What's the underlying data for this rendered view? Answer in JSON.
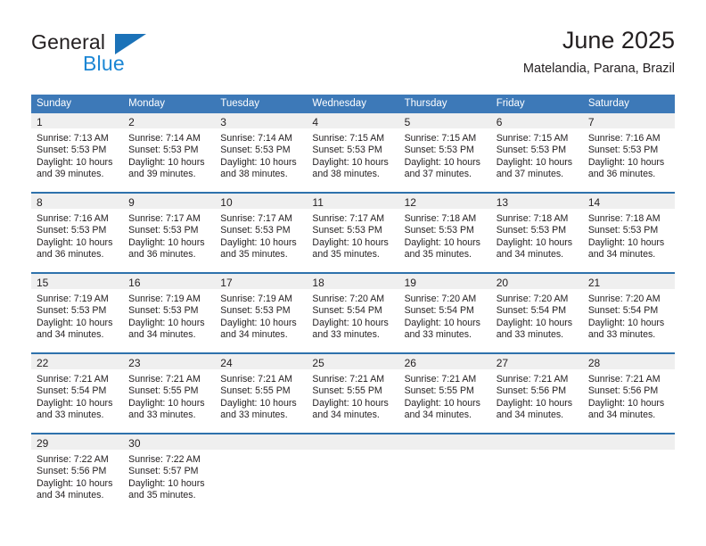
{
  "brand": {
    "name_top": "General",
    "name_bottom": "Blue",
    "triangle_color": "#1b72b8",
    "blue_text_color": "#1b86d4"
  },
  "header": {
    "title": "June 2025",
    "subtitle": "Matelandia, Parana, Brazil"
  },
  "theme": {
    "header_blue": "#3d79b8",
    "separator_blue": "#2e72ac",
    "daynum_band": "#efefef",
    "text": "#231f20"
  },
  "weekday_headers": [
    "Sunday",
    "Monday",
    "Tuesday",
    "Wednesday",
    "Thursday",
    "Friday",
    "Saturday"
  ],
  "weeks": [
    [
      {
        "day": "1",
        "sunrise": "Sunrise: 7:13 AM",
        "sunset": "Sunset: 5:53 PM",
        "daylight_line1": "Daylight: 10 hours",
        "daylight_line2": "and 39 minutes."
      },
      {
        "day": "2",
        "sunrise": "Sunrise: 7:14 AM",
        "sunset": "Sunset: 5:53 PM",
        "daylight_line1": "Daylight: 10 hours",
        "daylight_line2": "and 39 minutes."
      },
      {
        "day": "3",
        "sunrise": "Sunrise: 7:14 AM",
        "sunset": "Sunset: 5:53 PM",
        "daylight_line1": "Daylight: 10 hours",
        "daylight_line2": "and 38 minutes."
      },
      {
        "day": "4",
        "sunrise": "Sunrise: 7:15 AM",
        "sunset": "Sunset: 5:53 PM",
        "daylight_line1": "Daylight: 10 hours",
        "daylight_line2": "and 38 minutes."
      },
      {
        "day": "5",
        "sunrise": "Sunrise: 7:15 AM",
        "sunset": "Sunset: 5:53 PM",
        "daylight_line1": "Daylight: 10 hours",
        "daylight_line2": "and 37 minutes."
      },
      {
        "day": "6",
        "sunrise": "Sunrise: 7:15 AM",
        "sunset": "Sunset: 5:53 PM",
        "daylight_line1": "Daylight: 10 hours",
        "daylight_line2": "and 37 minutes."
      },
      {
        "day": "7",
        "sunrise": "Sunrise: 7:16 AM",
        "sunset": "Sunset: 5:53 PM",
        "daylight_line1": "Daylight: 10 hours",
        "daylight_line2": "and 36 minutes."
      }
    ],
    [
      {
        "day": "8",
        "sunrise": "Sunrise: 7:16 AM",
        "sunset": "Sunset: 5:53 PM",
        "daylight_line1": "Daylight: 10 hours",
        "daylight_line2": "and 36 minutes."
      },
      {
        "day": "9",
        "sunrise": "Sunrise: 7:17 AM",
        "sunset": "Sunset: 5:53 PM",
        "daylight_line1": "Daylight: 10 hours",
        "daylight_line2": "and 36 minutes."
      },
      {
        "day": "10",
        "sunrise": "Sunrise: 7:17 AM",
        "sunset": "Sunset: 5:53 PM",
        "daylight_line1": "Daylight: 10 hours",
        "daylight_line2": "and 35 minutes."
      },
      {
        "day": "11",
        "sunrise": "Sunrise: 7:17 AM",
        "sunset": "Sunset: 5:53 PM",
        "daylight_line1": "Daylight: 10 hours",
        "daylight_line2": "and 35 minutes."
      },
      {
        "day": "12",
        "sunrise": "Sunrise: 7:18 AM",
        "sunset": "Sunset: 5:53 PM",
        "daylight_line1": "Daylight: 10 hours",
        "daylight_line2": "and 35 minutes."
      },
      {
        "day": "13",
        "sunrise": "Sunrise: 7:18 AM",
        "sunset": "Sunset: 5:53 PM",
        "daylight_line1": "Daylight: 10 hours",
        "daylight_line2": "and 34 minutes."
      },
      {
        "day": "14",
        "sunrise": "Sunrise: 7:18 AM",
        "sunset": "Sunset: 5:53 PM",
        "daylight_line1": "Daylight: 10 hours",
        "daylight_line2": "and 34 minutes."
      }
    ],
    [
      {
        "day": "15",
        "sunrise": "Sunrise: 7:19 AM",
        "sunset": "Sunset: 5:53 PM",
        "daylight_line1": "Daylight: 10 hours",
        "daylight_line2": "and 34 minutes."
      },
      {
        "day": "16",
        "sunrise": "Sunrise: 7:19 AM",
        "sunset": "Sunset: 5:53 PM",
        "daylight_line1": "Daylight: 10 hours",
        "daylight_line2": "and 34 minutes."
      },
      {
        "day": "17",
        "sunrise": "Sunrise: 7:19 AM",
        "sunset": "Sunset: 5:53 PM",
        "daylight_line1": "Daylight: 10 hours",
        "daylight_line2": "and 34 minutes."
      },
      {
        "day": "18",
        "sunrise": "Sunrise: 7:20 AM",
        "sunset": "Sunset: 5:54 PM",
        "daylight_line1": "Daylight: 10 hours",
        "daylight_line2": "and 33 minutes."
      },
      {
        "day": "19",
        "sunrise": "Sunrise: 7:20 AM",
        "sunset": "Sunset: 5:54 PM",
        "daylight_line1": "Daylight: 10 hours",
        "daylight_line2": "and 33 minutes."
      },
      {
        "day": "20",
        "sunrise": "Sunrise: 7:20 AM",
        "sunset": "Sunset: 5:54 PM",
        "daylight_line1": "Daylight: 10 hours",
        "daylight_line2": "and 33 minutes."
      },
      {
        "day": "21",
        "sunrise": "Sunrise: 7:20 AM",
        "sunset": "Sunset: 5:54 PM",
        "daylight_line1": "Daylight: 10 hours",
        "daylight_line2": "and 33 minutes."
      }
    ],
    [
      {
        "day": "22",
        "sunrise": "Sunrise: 7:21 AM",
        "sunset": "Sunset: 5:54 PM",
        "daylight_line1": "Daylight: 10 hours",
        "daylight_line2": "and 33 minutes."
      },
      {
        "day": "23",
        "sunrise": "Sunrise: 7:21 AM",
        "sunset": "Sunset: 5:55 PM",
        "daylight_line1": "Daylight: 10 hours",
        "daylight_line2": "and 33 minutes."
      },
      {
        "day": "24",
        "sunrise": "Sunrise: 7:21 AM",
        "sunset": "Sunset: 5:55 PM",
        "daylight_line1": "Daylight: 10 hours",
        "daylight_line2": "and 33 minutes."
      },
      {
        "day": "25",
        "sunrise": "Sunrise: 7:21 AM",
        "sunset": "Sunset: 5:55 PM",
        "daylight_line1": "Daylight: 10 hours",
        "daylight_line2": "and 34 minutes."
      },
      {
        "day": "26",
        "sunrise": "Sunrise: 7:21 AM",
        "sunset": "Sunset: 5:55 PM",
        "daylight_line1": "Daylight: 10 hours",
        "daylight_line2": "and 34 minutes."
      },
      {
        "day": "27",
        "sunrise": "Sunrise: 7:21 AM",
        "sunset": "Sunset: 5:56 PM",
        "daylight_line1": "Daylight: 10 hours",
        "daylight_line2": "and 34 minutes."
      },
      {
        "day": "28",
        "sunrise": "Sunrise: 7:21 AM",
        "sunset": "Sunset: 5:56 PM",
        "daylight_line1": "Daylight: 10 hours",
        "daylight_line2": "and 34 minutes."
      }
    ],
    [
      {
        "day": "29",
        "sunrise": "Sunrise: 7:22 AM",
        "sunset": "Sunset: 5:56 PM",
        "daylight_line1": "Daylight: 10 hours",
        "daylight_line2": "and 34 minutes."
      },
      {
        "day": "30",
        "sunrise": "Sunrise: 7:22 AM",
        "sunset": "Sunset: 5:57 PM",
        "daylight_line1": "Daylight: 10 hours",
        "daylight_line2": "and 35 minutes."
      },
      {
        "day": "",
        "sunrise": "",
        "sunset": "",
        "daylight_line1": "",
        "daylight_line2": ""
      },
      {
        "day": "",
        "sunrise": "",
        "sunset": "",
        "daylight_line1": "",
        "daylight_line2": ""
      },
      {
        "day": "",
        "sunrise": "",
        "sunset": "",
        "daylight_line1": "",
        "daylight_line2": ""
      },
      {
        "day": "",
        "sunrise": "",
        "sunset": "",
        "daylight_line1": "",
        "daylight_line2": ""
      },
      {
        "day": "",
        "sunrise": "",
        "sunset": "",
        "daylight_line1": "",
        "daylight_line2": ""
      }
    ]
  ]
}
